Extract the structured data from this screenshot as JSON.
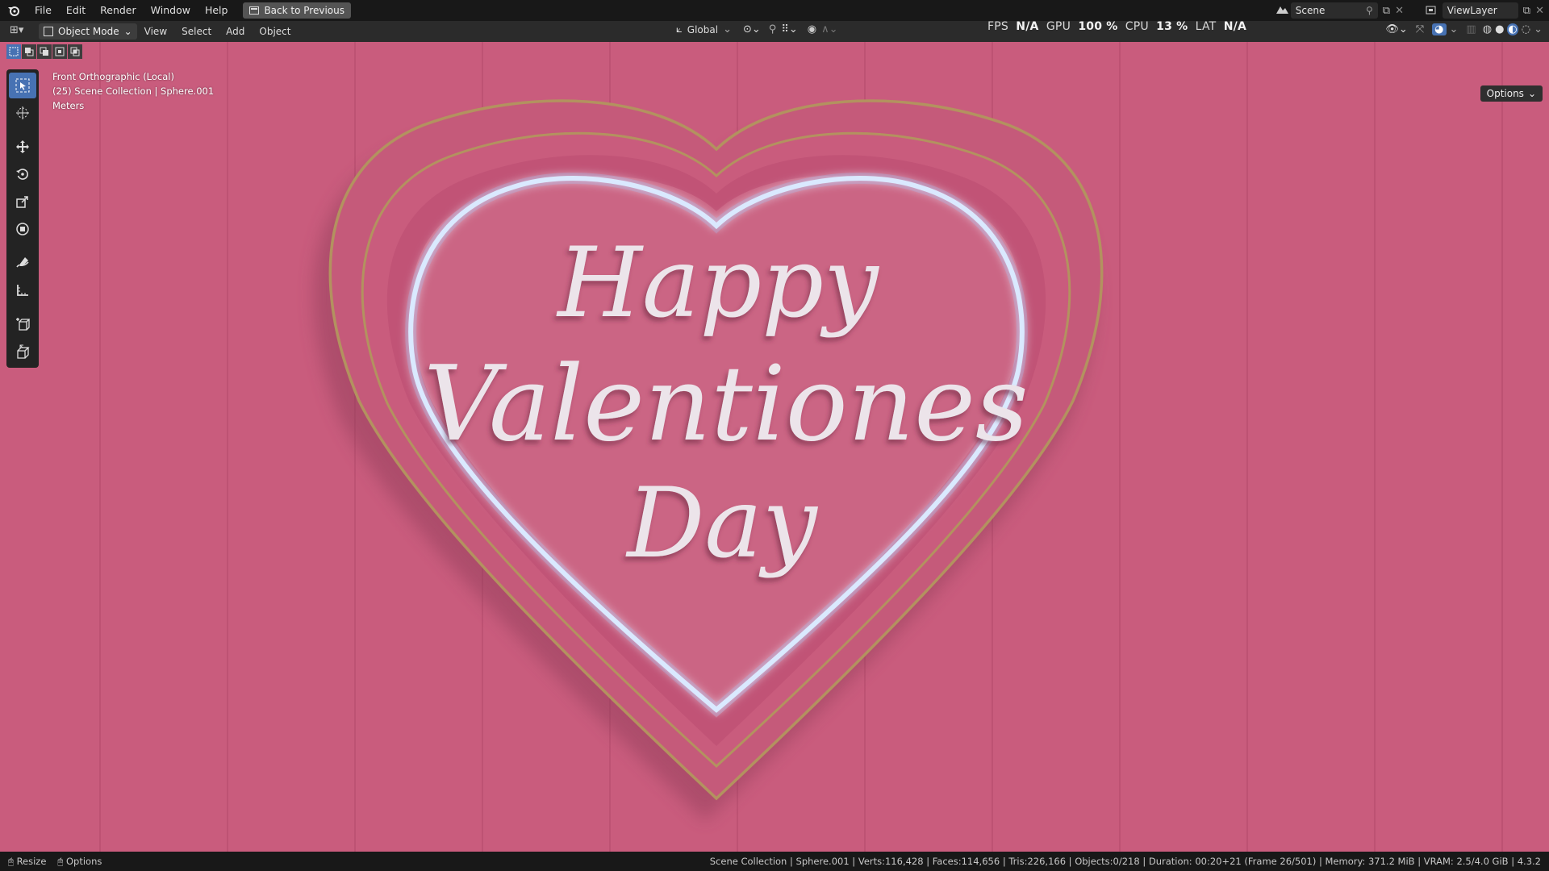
{
  "menubar": {
    "items": [
      "File",
      "Edit",
      "Render",
      "Window",
      "Help"
    ],
    "back_button": "Back to Previous",
    "scene": "Scene",
    "view_layer": "ViewLayer"
  },
  "header": {
    "mode": "Object Mode",
    "menus": [
      "View",
      "Select",
      "Add",
      "Object"
    ],
    "orientation": "Global",
    "options_label": "Options"
  },
  "perf": {
    "fps_label": "FPS",
    "fps_value": "N/A",
    "gpu_label": "GPU",
    "gpu_value": "100 %",
    "cpu_label": "CPU",
    "cpu_value": "13 %",
    "lat_label": "LAT",
    "lat_value": "N/A"
  },
  "viewport": {
    "view_name": "Front Orthographic (Local)",
    "collection": "(25) Scene Collection | Sphere.001",
    "units": "Meters",
    "text_line1": "Happy",
    "text_line2": "Valentiones",
    "text_line3": "Day",
    "bg_color": "#c95c7d",
    "neon_color": "#eef4ff",
    "gold_color": "#b3925f"
  },
  "statusbar": {
    "resize": "Resize",
    "options": "Options",
    "info": "Scene Collection | Sphere.001 | Verts:116,428 | Faces:114,656 | Tris:226,166 | Objects:0/218 | Duration: 00:20+21 (Frame 26/501) | Memory: 371.2 MiB | VRAM: 2.5/4.0 GiB | 4.3.2"
  },
  "tools": [
    "select-box-icon",
    "cursor-icon",
    "move-icon",
    "rotate-icon",
    "scale-icon",
    "transform-icon",
    "annotate-icon",
    "measure-icon",
    "add-cube-icon",
    "extrude-icon"
  ]
}
